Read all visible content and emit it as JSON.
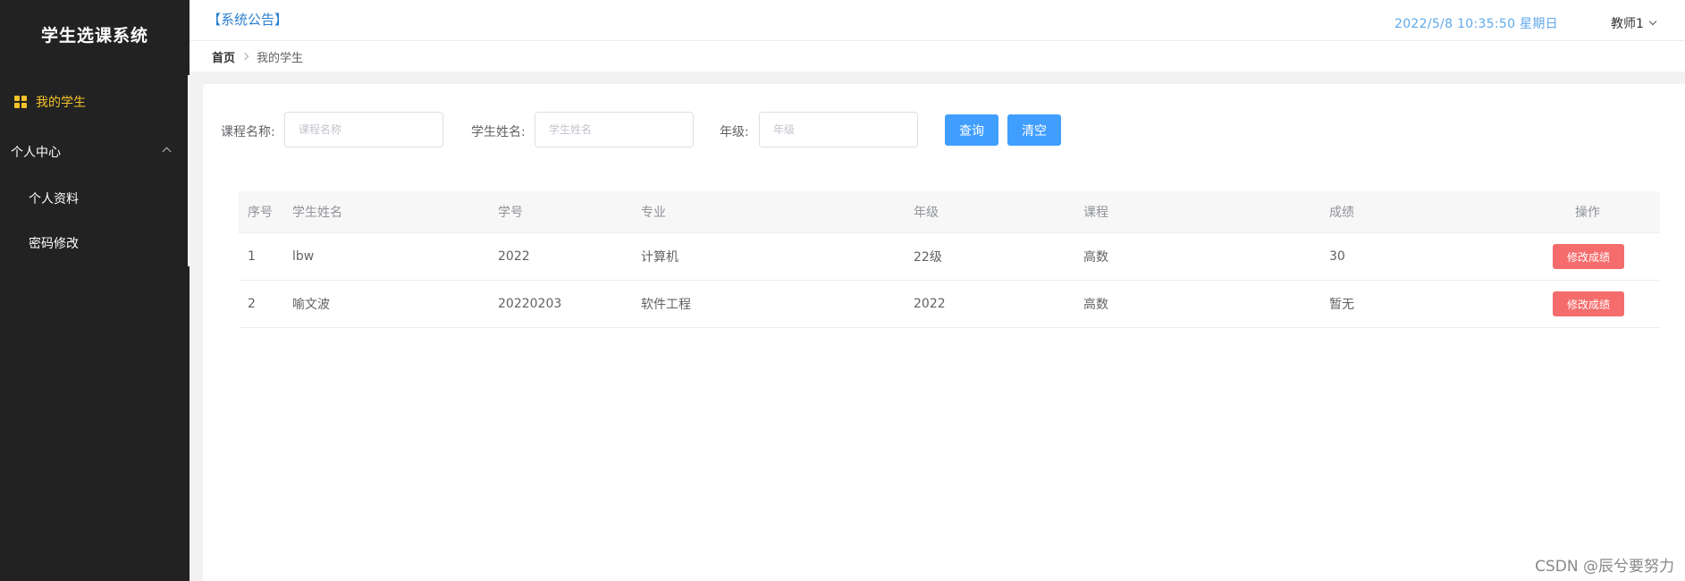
{
  "app": {
    "title": "学生选课系统"
  },
  "sidebar": {
    "items": [
      {
        "label": "我的学生",
        "active": true,
        "icon": "grid-icon"
      },
      {
        "label": "个人中心",
        "expanded": true,
        "icon": "chevron-up-icon"
      },
      {
        "label": "个人资料"
      },
      {
        "label": "密码修改"
      }
    ]
  },
  "header": {
    "notice": "【系统公告】",
    "datetime": "2022/5/8 10:35:50 星期日",
    "user": "教师1"
  },
  "breadcrumb": {
    "home": "首页",
    "current": "我的学生"
  },
  "search": {
    "course_label": "课程名称:",
    "course_placeholder": "课程名称",
    "student_label": "学生姓名:",
    "student_placeholder": "学生姓名",
    "grade_label": "年级:",
    "grade_placeholder": "年级",
    "query_label": "查询",
    "clear_label": "清空"
  },
  "table": {
    "columns": [
      "序号",
      "学生姓名",
      "学号",
      "专业",
      "年级",
      "课程",
      "成绩",
      "操作"
    ],
    "rows": [
      {
        "index": "1",
        "name": "lbw",
        "id": "2022",
        "major": "计算机",
        "grade": "22级",
        "course": "高数",
        "score": "30",
        "action": "修改成绩"
      },
      {
        "index": "2",
        "name": "喻文波",
        "id": "20220203",
        "major": "软件工程",
        "grade": "2022",
        "course": "高数",
        "score": "暂无",
        "action": "修改成绩"
      }
    ]
  },
  "watermark": "CSDN @辰兮要努力",
  "colors": {
    "sidebar_bg": "#222222",
    "accent": "#f5c22b",
    "primary": "#409eff",
    "danger": "#f56c6c"
  }
}
